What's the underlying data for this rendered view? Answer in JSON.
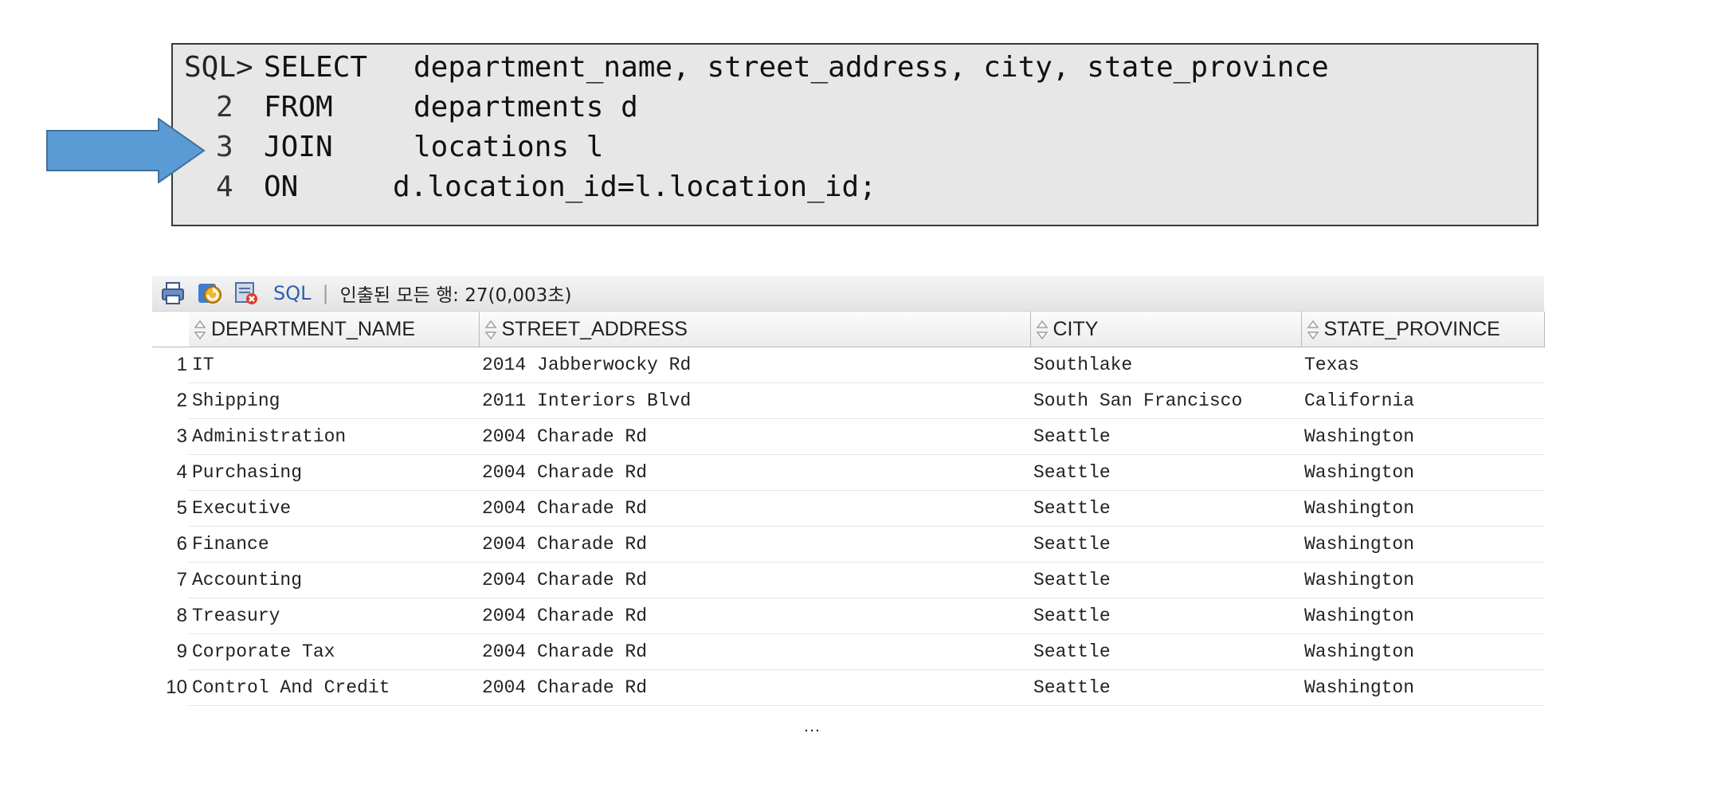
{
  "sql": {
    "prompt": "SQL>",
    "lines": [
      {
        "num": "",
        "keyword": "SELECT",
        "body": "department_name, street_address, city, state_province"
      },
      {
        "num": "2",
        "keyword": "FROM",
        "body": "departments d"
      },
      {
        "num": "3",
        "keyword": "JOIN",
        "body": "locations l"
      },
      {
        "num": "4",
        "keyword": "ON",
        "body": "d.location_id=l.location_id;"
      }
    ]
  },
  "arrow": {
    "color": "#5b9bd5",
    "border_color": "#41719c",
    "icon": "right-arrow"
  },
  "toolbar": {
    "icons": [
      "print-icon",
      "refresh-icon",
      "export-icon"
    ],
    "sql_label": "SQL",
    "separator": "|",
    "status": "인출된 모든 행: 27(0,003초)"
  },
  "grid": {
    "columns": [
      "DEPARTMENT_NAME",
      "STREET_ADDRESS",
      "CITY",
      "STATE_PROVINCE"
    ],
    "rows": [
      {
        "n": "1",
        "dept": "IT",
        "addr": "2014 Jabberwocky Rd",
        "city": "Southlake",
        "state": "Texas"
      },
      {
        "n": "2",
        "dept": "Shipping",
        "addr": "2011 Interiors Blvd",
        "city": "South San Francisco",
        "state": "California"
      },
      {
        "n": "3",
        "dept": "Administration",
        "addr": "2004 Charade Rd",
        "city": "Seattle",
        "state": "Washington"
      },
      {
        "n": "4",
        "dept": "Purchasing",
        "addr": "2004 Charade Rd",
        "city": "Seattle",
        "state": "Washington"
      },
      {
        "n": "5",
        "dept": "Executive",
        "addr": "2004 Charade Rd",
        "city": "Seattle",
        "state": "Washington"
      },
      {
        "n": "6",
        "dept": "Finance",
        "addr": "2004 Charade Rd",
        "city": "Seattle",
        "state": "Washington"
      },
      {
        "n": "7",
        "dept": "Accounting",
        "addr": "2004 Charade Rd",
        "city": "Seattle",
        "state": "Washington"
      },
      {
        "n": "8",
        "dept": "Treasury",
        "addr": "2004 Charade Rd",
        "city": "Seattle",
        "state": "Washington"
      },
      {
        "n": "9",
        "dept": "Corporate Tax",
        "addr": "2004 Charade Rd",
        "city": "Seattle",
        "state": "Washington"
      },
      {
        "n": "10",
        "dept": "Control And Credit",
        "addr": "2004 Charade Rd",
        "city": "Seattle",
        "state": "Washington"
      }
    ],
    "more": "…"
  }
}
